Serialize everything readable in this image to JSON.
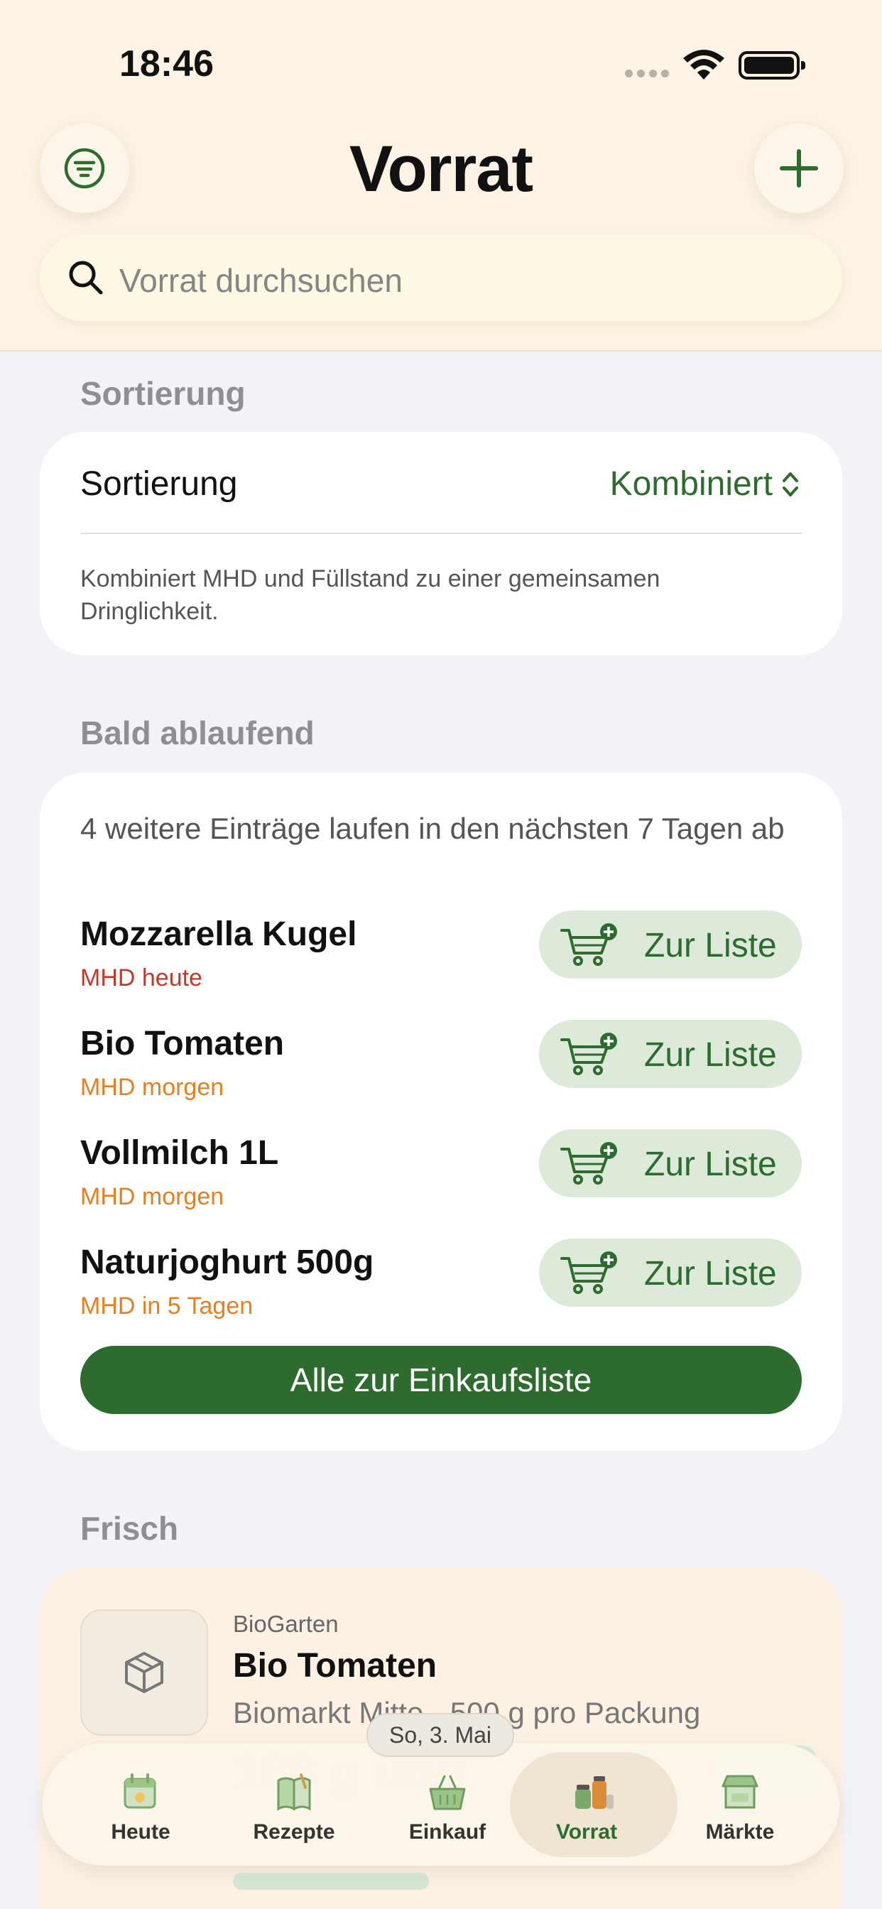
{
  "status_bar": {
    "time": "18:46"
  },
  "header": {
    "title": "Vorrat",
    "search_placeholder": "Vorrat durchsuchen",
    "filter_icon": "filter-icon",
    "add_icon": "plus-icon"
  },
  "sorting": {
    "section_title": "Sortierung",
    "label": "Sortierung",
    "value": "Kombiniert",
    "description": "Kombiniert MHD und Füllstand zu einer gemeinsamen Dringlichkeit."
  },
  "expiring": {
    "section_title": "Bald ablaufend",
    "summary": "4 weitere Einträge laufen in den nächsten 7 Tagen ab",
    "items": [
      {
        "name": "Mozzarella Kugel",
        "mhd": "MHD heute",
        "button": "Zur Liste"
      },
      {
        "name": "Bio Tomaten",
        "mhd": "MHD morgen",
        "button": "Zur Liste"
      },
      {
        "name": "Vollmilch 1L",
        "mhd": "MHD morgen",
        "button": "Zur Liste"
      },
      {
        "name": "Naturjoghurt 500g",
        "mhd": "MHD in 5 Tagen",
        "button": "Zur Liste"
      }
    ],
    "all_button": "Alle zur Einkaufsliste"
  },
  "fresh": {
    "section_title": "Frisch",
    "item": {
      "brand": "BioGarten",
      "name": "Bio Tomaten",
      "meta": "Biomarkt Mitte · 500 g pro Packung"
    }
  },
  "date_chip": "So, 3. Mai",
  "tabs": [
    {
      "label": "Heute",
      "icon": "calendar-icon"
    },
    {
      "label": "Rezepte",
      "icon": "recipe-book-icon"
    },
    {
      "label": "Einkauf",
      "icon": "basket-icon"
    },
    {
      "label": "Vorrat",
      "icon": "pantry-jars-icon"
    },
    {
      "label": "Märkte",
      "icon": "market-stall-icon"
    }
  ],
  "colors": {
    "accent": "#2e6b2f",
    "mhd_today": "#c0392b",
    "mhd_soon": "#e67e22",
    "header_bg": "#fdf3e4"
  }
}
